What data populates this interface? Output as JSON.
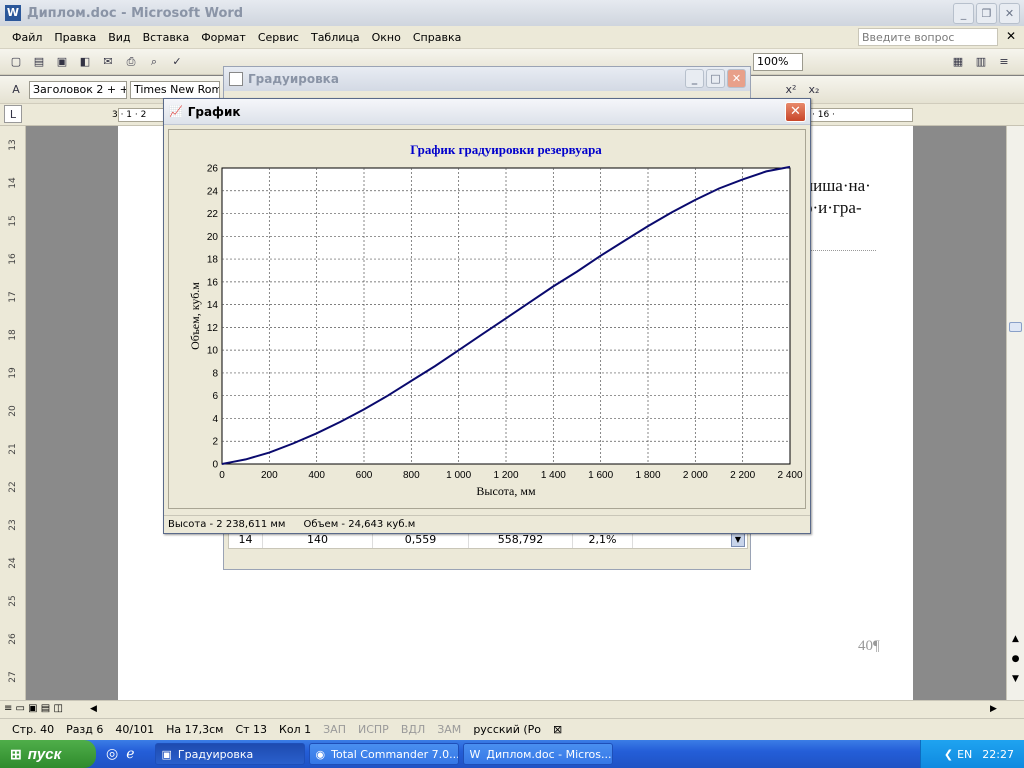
{
  "word": {
    "title": "Диплом.doc - Microsoft Word",
    "menu": [
      "Файл",
      "Правка",
      "Вид",
      "Вставка",
      "Формат",
      "Сервис",
      "Таблица",
      "Окно",
      "Справка"
    ],
    "ask_placeholder": "Введите вопрос",
    "zoom": "100%",
    "style": "Заголовок 2 + +",
    "font": "Times New Roman",
    "doc_text_line1": "ниша·на·",
    "doc_text_line2": "о·и·гра-",
    "page_number": "40¶",
    "ruler_left": "3 · 1 · 2",
    "ruler_right": "· 16 ·",
    "ruler_v": [
      "13",
      "14",
      "15",
      "16",
      "17",
      "18",
      "19",
      "20",
      "21",
      "22",
      "23",
      "24",
      "25",
      "26",
      "27"
    ]
  },
  "status": {
    "page": "Стр. 40",
    "section": "Разд 6",
    "pages": "40/101",
    "at": "На 17,3см",
    "line": "Ст 13",
    "col": "Кол 1",
    "zap": "ЗАП",
    "ispr": "ИСПР",
    "vdl": "ВДЛ",
    "zam": "ЗАМ",
    "lang": "русский (Ро"
  },
  "grad_window": {
    "title": "Градуировка",
    "row": [
      "14",
      "140",
      "0,559",
      "558,792",
      "2,1%"
    ]
  },
  "graph_window": {
    "title": "График",
    "status_height": "Высота - 2 238,611 мм",
    "status_volume": "Объем - 24,643 куб.м"
  },
  "taskbar": {
    "start": "пуск",
    "tasks": [
      "Градуировка",
      "Total Commander 7.0...",
      "Диплом.doc - Micros..."
    ],
    "clock": "22:27",
    "lang": "EN"
  },
  "colors": {
    "curve": "#0a0a6e",
    "title": "#0000cc"
  },
  "chart_data": {
    "type": "line",
    "title": "График градуировки резервуара",
    "xlabel": "Высота, мм",
    "ylabel": "Объем, куб.м",
    "xlim": [
      0,
      2400
    ],
    "ylim": [
      0,
      26
    ],
    "grid": true,
    "x_ticks": [
      "0",
      "200",
      "400",
      "600",
      "800",
      "1 000",
      "1 200",
      "1 400",
      "1 600",
      "1 800",
      "2 000",
      "2 200",
      "2 400"
    ],
    "y_ticks": [
      "0",
      "2",
      "4",
      "6",
      "8",
      "10",
      "12",
      "14",
      "16",
      "18",
      "20",
      "22",
      "24",
      "26"
    ],
    "series": [
      {
        "x": [
          0,
          50,
          100,
          200,
          300,
          400,
          500,
          600,
          700,
          800,
          900,
          1000,
          1100,
          1200,
          1300,
          1400,
          1500,
          1600,
          1700,
          1800,
          1900,
          2000,
          2100,
          2200,
          2300,
          2400
        ],
        "y": [
          0,
          0.2,
          0.4,
          1.0,
          1.8,
          2.7,
          3.7,
          4.8,
          6.0,
          7.3,
          8.6,
          10.0,
          11.4,
          12.8,
          14.2,
          15.6,
          16.9,
          18.3,
          19.6,
          20.9,
          22.1,
          23.2,
          24.2,
          25.0,
          25.7,
          26.1
        ]
      }
    ]
  }
}
